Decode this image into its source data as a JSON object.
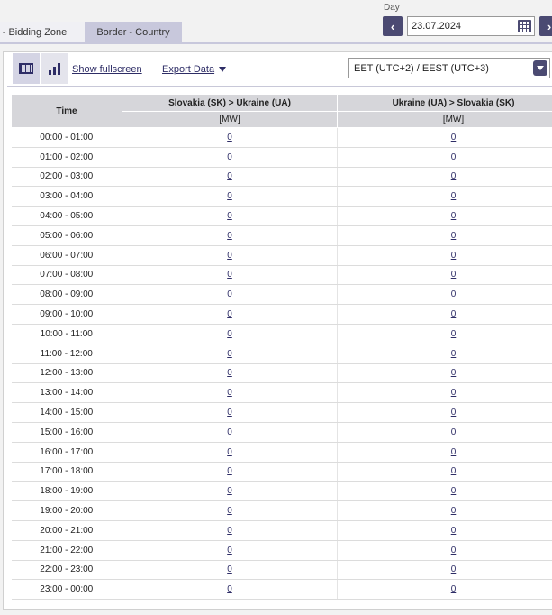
{
  "tabs": [
    {
      "label": "r - Bidding Zone"
    },
    {
      "label": "Border - Country"
    }
  ],
  "day": {
    "label": "Day",
    "value": "23.07.2024",
    "prev_icon": "chevron-left-icon",
    "next_icon": "chevron-right-icon",
    "calendar_icon": "calendar-icon"
  },
  "toolbar": {
    "show_fullscreen": "Show fullscreen",
    "export_data": "Export Data",
    "timezone": "EET (UTC+2) / EEST (UTC+3)"
  },
  "table": {
    "time_header": "Time",
    "columns": [
      {
        "name": "Slovakia (SK) > Ukraine (UA)",
        "unit": "[MW]"
      },
      {
        "name": "Ukraine (UA) > Slovakia (SK)",
        "unit": "[MW]"
      }
    ],
    "rows": [
      {
        "time": "00:00 - 01:00",
        "v1": "0",
        "v2": "0"
      },
      {
        "time": "01:00 - 02:00",
        "v1": "0",
        "v2": "0"
      },
      {
        "time": "02:00 - 03:00",
        "v1": "0",
        "v2": "0"
      },
      {
        "time": "03:00 - 04:00",
        "v1": "0",
        "v2": "0"
      },
      {
        "time": "04:00 - 05:00",
        "v1": "0",
        "v2": "0"
      },
      {
        "time": "05:00 - 06:00",
        "v1": "0",
        "v2": "0"
      },
      {
        "time": "06:00 - 07:00",
        "v1": "0",
        "v2": "0"
      },
      {
        "time": "07:00 - 08:00",
        "v1": "0",
        "v2": "0"
      },
      {
        "time": "08:00 - 09:00",
        "v1": "0",
        "v2": "0"
      },
      {
        "time": "09:00 - 10:00",
        "v1": "0",
        "v2": "0"
      },
      {
        "time": "10:00 - 11:00",
        "v1": "0",
        "v2": "0"
      },
      {
        "time": "11:00 - 12:00",
        "v1": "0",
        "v2": "0"
      },
      {
        "time": "12:00 - 13:00",
        "v1": "0",
        "v2": "0"
      },
      {
        "time": "13:00 - 14:00",
        "v1": "0",
        "v2": "0"
      },
      {
        "time": "14:00 - 15:00",
        "v1": "0",
        "v2": "0"
      },
      {
        "time": "15:00 - 16:00",
        "v1": "0",
        "v2": "0"
      },
      {
        "time": "16:00 - 17:00",
        "v1": "0",
        "v2": "0"
      },
      {
        "time": "17:00 - 18:00",
        "v1": "0",
        "v2": "0"
      },
      {
        "time": "18:00 - 19:00",
        "v1": "0",
        "v2": "0"
      },
      {
        "time": "19:00 - 20:00",
        "v1": "0",
        "v2": "0"
      },
      {
        "time": "20:00 - 21:00",
        "v1": "0",
        "v2": "0"
      },
      {
        "time": "21:00 - 22:00",
        "v1": "0",
        "v2": "0"
      },
      {
        "time": "22:00 - 23:00",
        "v1": "0",
        "v2": "0"
      },
      {
        "time": "23:00 - 00:00",
        "v1": "0",
        "v2": "0"
      }
    ]
  },
  "colors": {
    "accent": "#4b4a72",
    "header_bg": "#d6d6da",
    "link": "#2e2d66",
    "tab_active": "#c8c8dc"
  }
}
